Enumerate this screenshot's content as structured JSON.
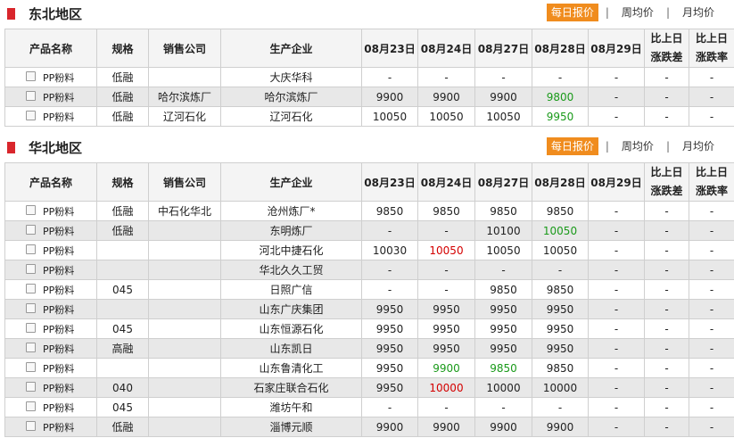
{
  "headers": [
    "产品名称",
    "规格",
    "销售公司",
    "生产企业",
    "08月23日",
    "08月24日",
    "08月27日",
    "08月28日",
    "08月29日"
  ],
  "diff_header": [
    "比上日",
    "涨跌差"
  ],
  "rate_header": [
    "比上日",
    "涨跌率"
  ],
  "tabs": {
    "daily": "每日报价",
    "weekly": "周均价",
    "monthly": "月均价",
    "separator": "|"
  },
  "colors": {
    "accent_tab": "#f08c1e",
    "section_marker": "#d9262c",
    "price_up": "#d40000",
    "price_down": "#1a9a1a"
  },
  "sections": [
    {
      "title": "东北地区",
      "rows": [
        {
          "product": "PP粉料",
          "grade": "低融",
          "seller": "",
          "producer": "大庆华科",
          "prices": [
            "-",
            "-",
            "-",
            "-",
            "-"
          ],
          "trend": [
            "",
            "",
            "",
            "",
            ""
          ],
          "diff": "-",
          "rate": "-"
        },
        {
          "product": "PP粉料",
          "grade": "低融",
          "seller": "哈尔滨炼厂",
          "producer": "哈尔滨炼厂",
          "prices": [
            "9900",
            "9900",
            "9900",
            "9800",
            "-"
          ],
          "trend": [
            "",
            "",
            "",
            "down",
            ""
          ],
          "diff": "-",
          "rate": "-"
        },
        {
          "product": "PP粉料",
          "grade": "低融",
          "seller": "辽河石化",
          "producer": "辽河石化",
          "prices": [
            "10050",
            "10050",
            "10050",
            "9950",
            "-"
          ],
          "trend": [
            "",
            "",
            "",
            "down",
            ""
          ],
          "diff": "-",
          "rate": "-"
        }
      ]
    },
    {
      "title": "华北地区",
      "rows": [
        {
          "product": "PP粉料",
          "grade": "低融",
          "seller": "中石化华北",
          "producer": "沧州炼厂*",
          "prices": [
            "9850",
            "9850",
            "9850",
            "9850",
            "-"
          ],
          "trend": [
            "",
            "",
            "",
            "",
            ""
          ],
          "diff": "-",
          "rate": "-"
        },
        {
          "product": "PP粉料",
          "grade": "低融",
          "seller": "",
          "producer": "东明炼厂",
          "prices": [
            "-",
            "-",
            "10100",
            "10050",
            "-"
          ],
          "trend": [
            "",
            "",
            "",
            "down",
            ""
          ],
          "diff": "-",
          "rate": "-"
        },
        {
          "product": "PP粉料",
          "grade": "",
          "seller": "",
          "producer": "河北中捷石化",
          "prices": [
            "10030",
            "10050",
            "10050",
            "10050",
            "-"
          ],
          "trend": [
            "",
            "up",
            "",
            "",
            ""
          ],
          "diff": "-",
          "rate": "-"
        },
        {
          "product": "PP粉料",
          "grade": "",
          "seller": "",
          "producer": "华北久久工贸",
          "prices": [
            "-",
            "-",
            "-",
            "-",
            "-"
          ],
          "trend": [
            "",
            "",
            "",
            "",
            ""
          ],
          "diff": "-",
          "rate": "-"
        },
        {
          "product": "PP粉料",
          "grade": "045",
          "seller": "",
          "producer": "日照广信",
          "prices": [
            "-",
            "-",
            "9850",
            "9850",
            "-"
          ],
          "trend": [
            "",
            "",
            "",
            "",
            ""
          ],
          "diff": "-",
          "rate": "-"
        },
        {
          "product": "PP粉料",
          "grade": "",
          "seller": "",
          "producer": "山东广庆集团",
          "prices": [
            "9950",
            "9950",
            "9950",
            "9950",
            "-"
          ],
          "trend": [
            "",
            "",
            "",
            "",
            ""
          ],
          "diff": "-",
          "rate": "-"
        },
        {
          "product": "PP粉料",
          "grade": "045",
          "seller": "",
          "producer": "山东恒源石化",
          "prices": [
            "9950",
            "9950",
            "9950",
            "9950",
            "-"
          ],
          "trend": [
            "",
            "",
            "",
            "",
            ""
          ],
          "diff": "-",
          "rate": "-"
        },
        {
          "product": "PP粉料",
          "grade": "高融",
          "seller": "",
          "producer": "山东凯日",
          "prices": [
            "9950",
            "9950",
            "9950",
            "9950",
            "-"
          ],
          "trend": [
            "",
            "",
            "",
            "",
            ""
          ],
          "diff": "-",
          "rate": "-"
        },
        {
          "product": "PP粉料",
          "grade": "",
          "seller": "",
          "producer": "山东鲁清化工",
          "prices": [
            "9950",
            "9900",
            "9850",
            "9850",
            "-"
          ],
          "trend": [
            "",
            "down",
            "down",
            "",
            ""
          ],
          "diff": "-",
          "rate": "-"
        },
        {
          "product": "PP粉料",
          "grade": "040",
          "seller": "",
          "producer": "石家庄联合石化",
          "prices": [
            "9950",
            "10000",
            "10000",
            "10000",
            "-"
          ],
          "trend": [
            "",
            "up",
            "",
            "",
            ""
          ],
          "diff": "-",
          "rate": "-"
        },
        {
          "product": "PP粉料",
          "grade": "045",
          "seller": "",
          "producer": "潍坊午和",
          "prices": [
            "-",
            "-",
            "-",
            "-",
            "-"
          ],
          "trend": [
            "",
            "",
            "",
            "",
            ""
          ],
          "diff": "-",
          "rate": "-"
        },
        {
          "product": "PP粉料",
          "grade": "低融",
          "seller": "",
          "producer": "淄博元顺",
          "prices": [
            "9900",
            "9900",
            "9900",
            "9900",
            "-"
          ],
          "trend": [
            "",
            "",
            "",
            "",
            ""
          ],
          "diff": "-",
          "rate": "-"
        }
      ]
    }
  ]
}
